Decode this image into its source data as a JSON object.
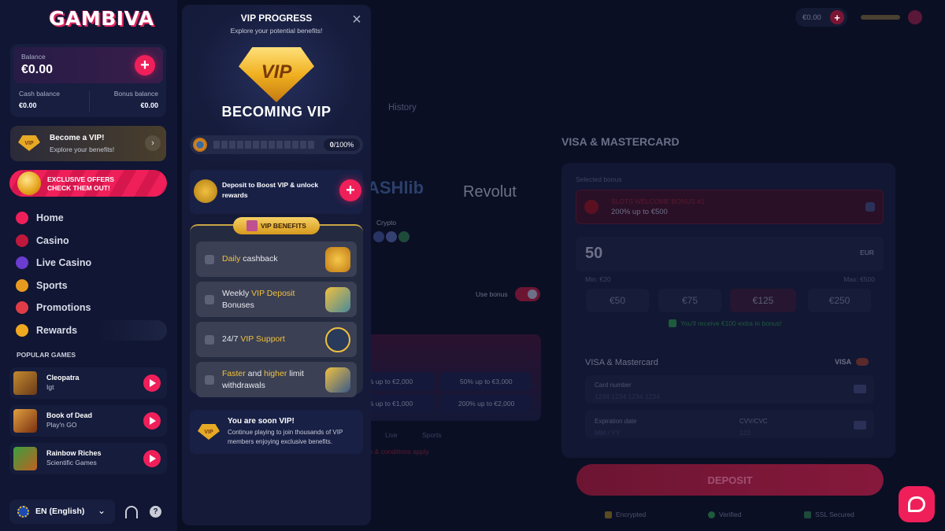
{
  "sidebar": {
    "logo": "GAMBIVA",
    "balance": {
      "label": "Balance",
      "value": "€0.00",
      "cash_label": "Cash balance",
      "cash_value": "€0.00",
      "bonus_label": "Bonus balance",
      "bonus_value": "€0.00"
    },
    "vip": {
      "badge": "VIP",
      "title": "Become a VIP!",
      "subtitle": "Explore your benefits!"
    },
    "offers": {
      "line1": "EXCLUSIVE OFFERS",
      "line2": "CHECK THEM OUT!"
    },
    "nav": [
      {
        "label": "Home",
        "icon": "home-icon"
      },
      {
        "label": "Casino",
        "icon": "cherry-icon"
      },
      {
        "label": "Live Casino",
        "icon": "live-casino-icon"
      },
      {
        "label": "Sports",
        "icon": "sports-icon"
      },
      {
        "label": "Promotions",
        "icon": "promotions-icon"
      },
      {
        "label": "Rewards",
        "icon": "rewards-icon"
      }
    ],
    "popular_title": "POPULAR GAMES",
    "games": [
      {
        "name": "Cleopatra",
        "provider": "Igt"
      },
      {
        "name": "Book of Dead",
        "provider": "Play'n GO"
      },
      {
        "name": "Rainbow Riches",
        "provider": "Scientific Games"
      }
    ],
    "language": "EN (English)"
  },
  "header": {
    "balance": "€0.00"
  },
  "main": {
    "tab_history": "History",
    "method_title": "VISA & MASTERCARD",
    "provider_cashlib": "ASHlib",
    "provider_revolut": "Revolut",
    "crypto_label": "Crypto",
    "use_bonus": "Use bonus",
    "bonus_options": [
      "% up to €2,000",
      "50% up to €3,000",
      "% up to €1,000",
      "200% up to €2,000"
    ],
    "filter_live": "Live",
    "filter_sports": "Sports",
    "terms": "s & conditions apply",
    "selected_bonus_label": "Selected bonus",
    "selected_bonus_title": "SLOTS WELCOME BONUS #1",
    "selected_bonus_desc": "200% up to €500",
    "amount": "50",
    "currency": "EUR",
    "min": "Min: €20",
    "max": "Max: €500",
    "amounts": [
      "€50",
      "€75",
      "€125",
      "€250"
    ],
    "extra_bonus": "You'll receive €100 extra in bonus!",
    "card_section": "VISA & Mastercard",
    "card_brand": "VISA",
    "card_number_label": "Card number",
    "card_number_placeholder": "1234 1234 1234 1234",
    "expiry_label": "Expiration date",
    "expiry_placeholder": "MM / YY",
    "cvv_label": "CVV/CVC",
    "cvv_placeholder": "123",
    "deposit_button": "DEPOSIT",
    "trust": [
      "Encrypted",
      "Verified",
      "SSL Secured"
    ]
  },
  "vip_panel": {
    "title": "VIP PROGRESS",
    "subtitle": "Explore your potential benefits!",
    "gem_text": "VIP",
    "heading": "BECOMING VIP",
    "progress_text": "0",
    "progress_max": "/100%",
    "progress_fraction": 0,
    "boost_text": "Deposit to Boost VIP & unlock rewards",
    "benefits_title": "VIP BENEFITS",
    "benefits": [
      {
        "highlight": "Daily",
        "rest": " cashback",
        "pre": "",
        "icon": "coins-icon"
      },
      {
        "pre": "Weekly ",
        "highlight": "VIP Deposit",
        "rest": " Bonuses",
        "icon": "wallet-icon"
      },
      {
        "pre": "24/7 ",
        "highlight": "VIP Support",
        "rest": "",
        "icon": "chat-bubble-icon"
      },
      {
        "pre": "",
        "highlight": "Faster",
        "mid": " and ",
        "highlight2": "higher",
        "rest": " limit withdrawals",
        "icon": "fast-cart-icon"
      }
    ],
    "soon_title": "You are soon VIP!",
    "soon_text": "Continue playing to join thousands of VIP members enjoying exclusive benefits.",
    "soon_badge": "VIP"
  },
  "colors": {
    "accent": "#ef1f5a",
    "gold": "#f2c23a",
    "panel": "#141a38",
    "background": "#0b0f24"
  }
}
